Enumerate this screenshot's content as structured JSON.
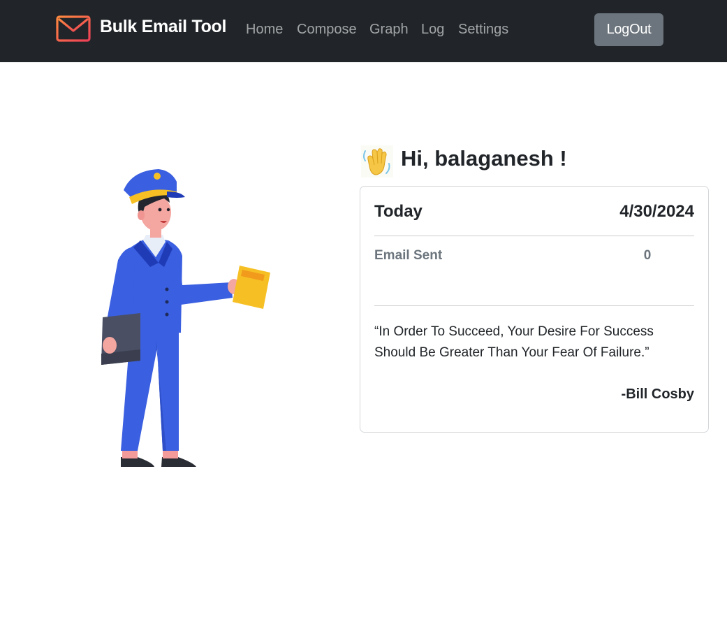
{
  "navbar": {
    "brand": "Bulk Email Tool",
    "brand_icon": "envelope-icon",
    "links": [
      "Home",
      "Compose",
      "Graph",
      "Log",
      "Settings"
    ],
    "logout_label": "LogOut",
    "colors": {
      "background": "#212529",
      "link": "rgba(255,255,255,0.58)",
      "button": "#6c757d",
      "brand_icon_gradient": [
        "#fd8a40",
        "#ee3f57"
      ]
    }
  },
  "hero": {
    "illustration": "mail-carrier-illustration",
    "greeting_icon": "waving-hand-icon",
    "greeting": "Hi, balaganesh !"
  },
  "card": {
    "today_label": "Today",
    "date": "4/30/2024",
    "stat_label": "Email Sent",
    "stat_value": "0",
    "quote": "“In Order To Succeed, Your Desire For Success Should Be Greater Than Your Fear Of Failure.”",
    "author": "-Bill Cosby"
  }
}
